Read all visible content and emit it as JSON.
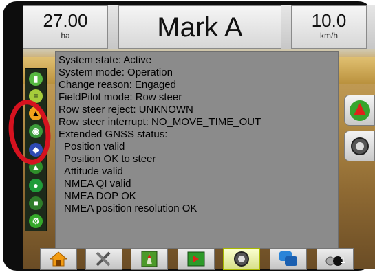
{
  "header": {
    "area_value": "27.00",
    "area_unit": "ha",
    "title": "Mark A",
    "speed_value": "10.0",
    "speed_unit": "km/h"
  },
  "status_lines": [
    "System state: Active",
    "System mode: Operation",
    "Change reason: Engaged",
    "FieldPilot mode: Row steer",
    "Row steer reject: UNKNOWN",
    "Row steer interrupt: NO_MOVE_TIME_OUT",
    "Extended GNSS status:",
    "  Position valid",
    "  Position OK to steer",
    "  Attitude valid",
    "  NMEA QI valid",
    "  NMEA DOP OK",
    "  NMEA position resolution OK"
  ],
  "left_toolbar": {
    "icons": [
      "steering-icon",
      "row-guidance-icon",
      "row-steer-icon",
      "tractor-icon",
      "lightbar-icon",
      "guidance-icon",
      "water-drop-icon",
      "hitch-icon",
      "gear-icon"
    ]
  },
  "right_toolbar": {
    "icons": [
      "guidance-arrow-icon",
      "camera-icon"
    ]
  },
  "bottom_bar": {
    "buttons": [
      {
        "icon": "home-icon",
        "active": false
      },
      {
        "icon": "tools-icon",
        "active": false
      },
      {
        "icon": "guidance-view-icon",
        "active": false
      },
      {
        "icon": "field-map-icon",
        "active": false
      },
      {
        "icon": "camera-icon",
        "active": true
      },
      {
        "icon": "screen-switch-icon",
        "active": false
      },
      {
        "icon": "camera-selector-icon",
        "active": false,
        "badge": "1"
      }
    ]
  },
  "colors": {
    "highlight": "#d5121f",
    "active_button": "#d8e08a",
    "panel_bg": "#8b8b8b"
  }
}
